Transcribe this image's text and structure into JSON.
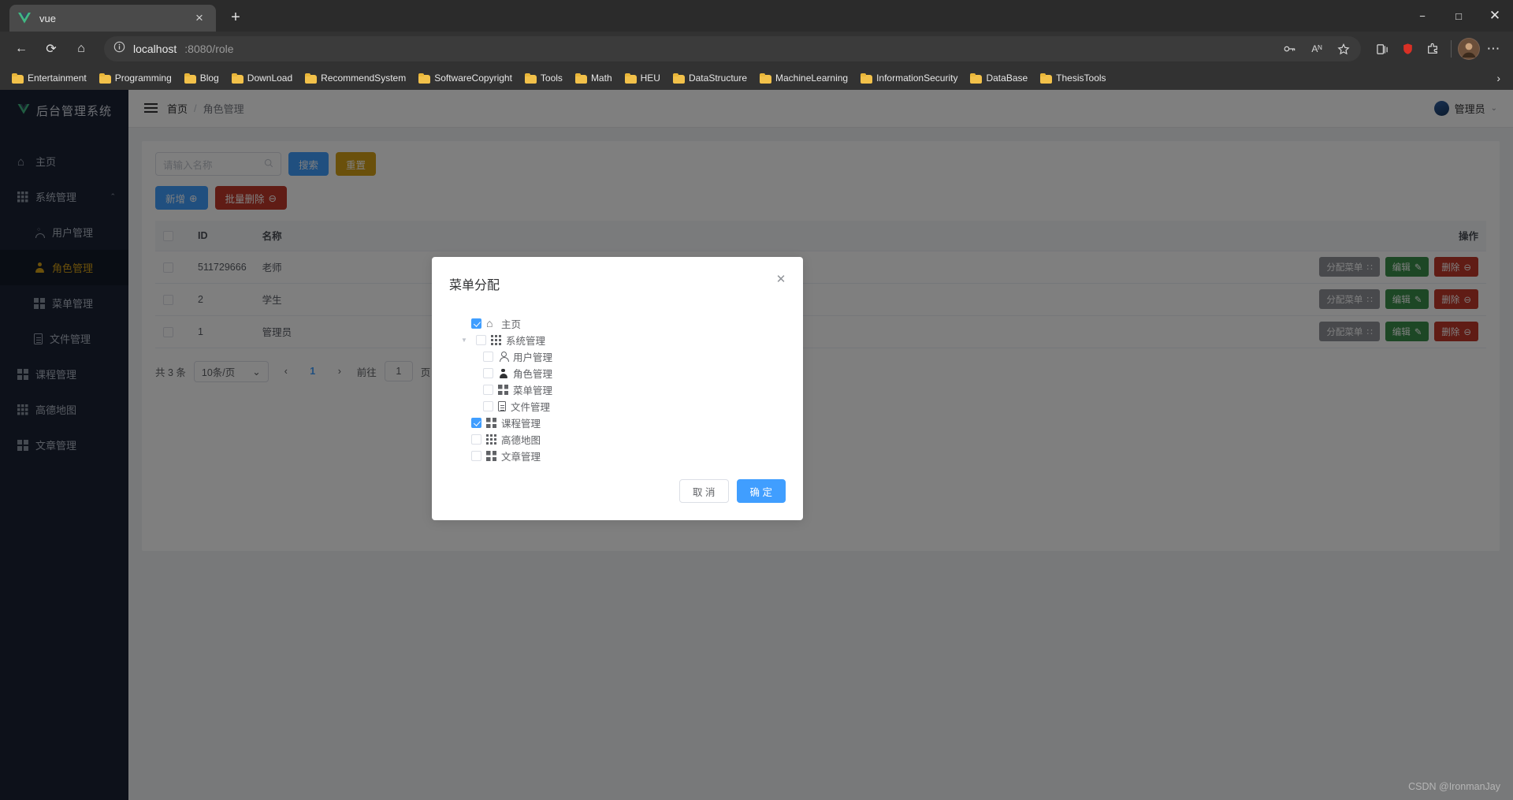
{
  "browser": {
    "tab": {
      "title": "vue",
      "favicon": "vue-logo-icon",
      "close": "×"
    },
    "newtab_label": "+",
    "window_controls": {
      "minimize": "−",
      "maximize": "□",
      "close": "✕"
    },
    "nav": {
      "back": "←",
      "reload": "⟳",
      "home": "⌂"
    },
    "omnibox": {
      "info_icon": "info-icon",
      "host": "localhost",
      "path": ":8080/role"
    },
    "omnibox_right": {
      "key_icon": "🗝",
      "read_aloud": "Aᴺ",
      "favorite": "☆"
    },
    "toolbar_right": {
      "collections": "◱",
      "shield": "●",
      "extensions": "⧉",
      "settings": "⋯"
    },
    "bookmarks": [
      "Entertainment",
      "Programming",
      "Blog",
      "DownLoad",
      "RecommendSystem",
      "SoftwareCopyright",
      "Tools",
      "Math",
      "HEU",
      "DataStructure",
      "MachineLearning",
      "InformationSecurity",
      "DataBase",
      "ThesisTools"
    ],
    "bookmarks_overflow": "›"
  },
  "sidebar": {
    "logo_mark": "V",
    "logo_text": "后台管理系统",
    "items": [
      {
        "label": "主页",
        "icon": "home-icon",
        "level": 0,
        "active": false,
        "arrow": ""
      },
      {
        "label": "系统管理",
        "icon": "grid9-icon",
        "level": 0,
        "active": false,
        "arrow": "⌃"
      },
      {
        "label": "用户管理",
        "icon": "user-outline-icon",
        "level": 1,
        "active": false,
        "arrow": ""
      },
      {
        "label": "角色管理",
        "icon": "user-solid-icon",
        "level": 1,
        "active": true,
        "arrow": ""
      },
      {
        "label": "菜单管理",
        "icon": "grid4-icon",
        "level": 1,
        "active": false,
        "arrow": ""
      },
      {
        "label": "文件管理",
        "icon": "file-icon",
        "level": 1,
        "active": false,
        "arrow": ""
      },
      {
        "label": "课程管理",
        "icon": "grid4-icon",
        "level": 0,
        "active": false,
        "arrow": ""
      },
      {
        "label": "高德地图",
        "icon": "grid9-icon",
        "level": 0,
        "active": false,
        "arrow": ""
      },
      {
        "label": "文章管理",
        "icon": "grid4-icon",
        "level": 0,
        "active": false,
        "arrow": ""
      }
    ]
  },
  "topbar": {
    "menu_toggle": "hamburger-icon",
    "breadcrumb_root": "首页",
    "breadcrumb_sep": "/",
    "breadcrumb_current": "角色管理",
    "user_name": "管理员",
    "user_caret": "⌄"
  },
  "toolbar": {
    "search_placeholder": "请输入名称",
    "search_value": "",
    "search_icon": "search-icon",
    "search_button": "搜索",
    "reset_button": "重置",
    "add_button": "新增",
    "add_icon": "⊕",
    "batch_delete_button": "批量删除",
    "batch_delete_icon": "⊖"
  },
  "table": {
    "columns": [
      "",
      "ID",
      "名称",
      "操作"
    ],
    "rows": [
      {
        "id": "511729666",
        "name": "老师"
      },
      {
        "id": "2",
        "name": "学生"
      },
      {
        "id": "1",
        "name": "管理员"
      }
    ],
    "row_actions": {
      "assign_menu": "分配菜单",
      "assign_icon": "∷",
      "edit": "编辑",
      "edit_icon": "✎",
      "delete": "删除",
      "delete_icon": "⊖"
    }
  },
  "pagination": {
    "total_text": "共 3 条",
    "page_size": "10条/页",
    "page_size_caret": "⌄",
    "prev": "‹",
    "next": "›",
    "pages": [
      "1"
    ],
    "current_page": "1",
    "goto_label": "前往",
    "goto_value": "1",
    "goto_unit": "页"
  },
  "modal": {
    "title": "菜单分配",
    "close": "✕",
    "tree": [
      {
        "label": "主页",
        "icon": "home-icon",
        "level": 0,
        "checked": true,
        "arrow": false
      },
      {
        "label": "系统管理",
        "icon": "grid9-icon",
        "level": 0,
        "checked": false,
        "arrow": true
      },
      {
        "label": "用户管理",
        "icon": "user-outline-icon",
        "level": 1,
        "checked": false,
        "arrow": false
      },
      {
        "label": "角色管理",
        "icon": "user-solid-icon",
        "level": 1,
        "checked": false,
        "arrow": false
      },
      {
        "label": "菜单管理",
        "icon": "grid4-icon",
        "level": 1,
        "checked": false,
        "arrow": false
      },
      {
        "label": "文件管理",
        "icon": "file-icon",
        "level": 1,
        "checked": false,
        "arrow": false
      },
      {
        "label": "课程管理",
        "icon": "grid4-icon",
        "level": 0,
        "checked": true,
        "arrow": false
      },
      {
        "label": "高德地图",
        "icon": "grid9-icon",
        "level": 0,
        "checked": false,
        "arrow": false
      },
      {
        "label": "文章管理",
        "icon": "grid4-icon",
        "level": 0,
        "checked": false,
        "arrow": false
      }
    ],
    "cancel_button": "取 消",
    "confirm_button": "确 定",
    "tree_expand_arrow": "▼"
  },
  "watermark": "CSDN @IronmanJay",
  "colors": {
    "accent_blue": "#409eff",
    "sidebar_bg": "#1a2234",
    "active_gold": "#d4a017",
    "danger_red": "#c0392b",
    "success_green": "#3b8f4a"
  }
}
